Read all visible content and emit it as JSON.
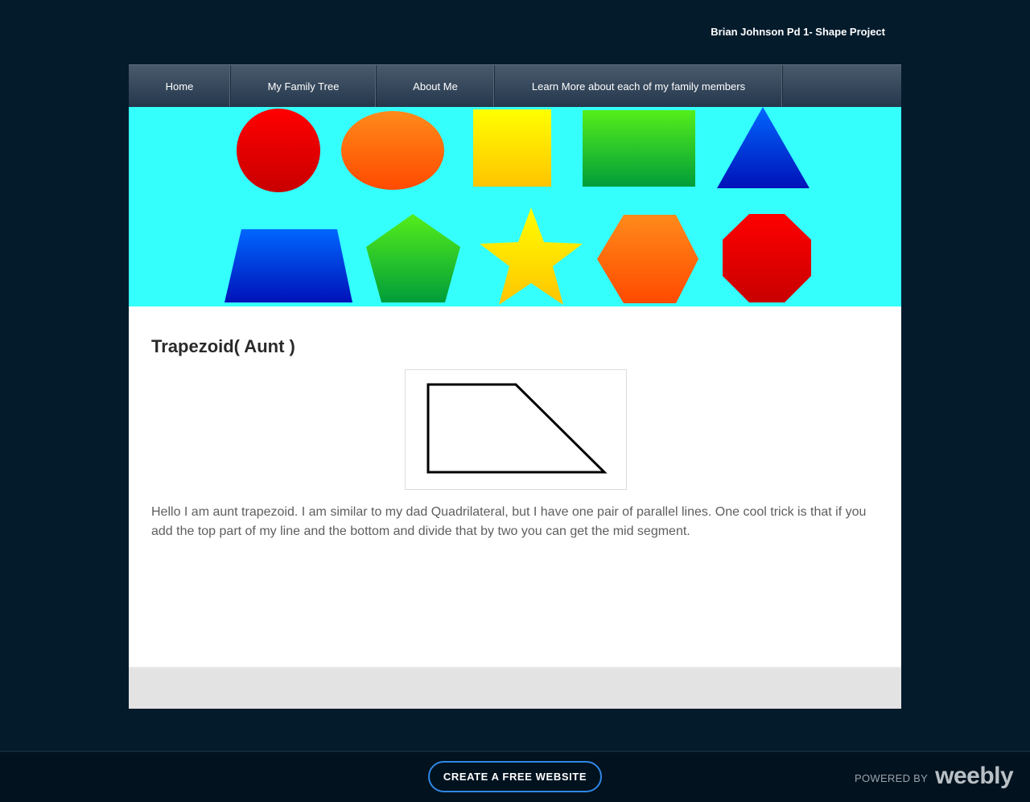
{
  "header": {
    "site_title": "Brian Johnson Pd 1- Shape Project"
  },
  "nav": {
    "items": [
      {
        "label": "Home"
      },
      {
        "label": "My Family Tree"
      },
      {
        "label": "About Me"
      },
      {
        "label": "Learn More about each of my family members"
      }
    ]
  },
  "banner": {
    "shapes": [
      "circle",
      "ellipse",
      "square",
      "rectangle",
      "triangle",
      "trapezoid",
      "pentagon",
      "star",
      "hexagon",
      "octagon"
    ],
    "background_color": "#35fffd"
  },
  "main": {
    "heading": "Trapezoid( Aunt )",
    "paragraph": "Hello I am aunt trapezoid. I am similar to my dad Quadrilateral, but I have one pair of parallel lines. One cool trick is that if you add the top part of my line and the bottom and divide that by two you can get the mid segment."
  },
  "footer": {
    "create_button_label": "CREATE A FREE WEBSITE",
    "powered_by_label": "POWERED BY",
    "logo_text": "weebly"
  },
  "colors": {
    "page_background": "#041b2c",
    "button_border": "#2f87e6"
  }
}
